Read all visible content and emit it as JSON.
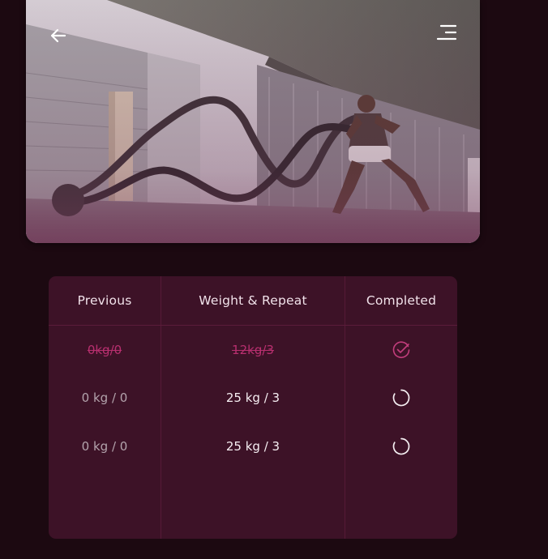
{
  "hero": {
    "image_description_icon": "battle-ropes-photo",
    "back_icon": "arrow-left-icon",
    "menu_icon": "menu-lines-icon"
  },
  "table": {
    "headers": {
      "previous": "Previous",
      "weight_repeat": "Weight & Repeat",
      "completed": "Completed"
    },
    "rows": [
      {
        "previous": "0kg/0",
        "weight_repeat": "12kg/3",
        "status": "completed",
        "status_icon": "check-circle-icon"
      },
      {
        "previous": "0 kg / 0",
        "weight_repeat": "25 kg / 3",
        "status": "pending",
        "status_icon": "loading-spinner-icon"
      },
      {
        "previous": "0 kg / 0",
        "weight_repeat": "25 kg / 3",
        "status": "pending",
        "status_icon": "loading-spinner-icon"
      }
    ]
  },
  "colors": {
    "background": "#1c0911",
    "card": "#3d1227",
    "accent": "#b82f6f",
    "text": "#f1e2ea"
  }
}
